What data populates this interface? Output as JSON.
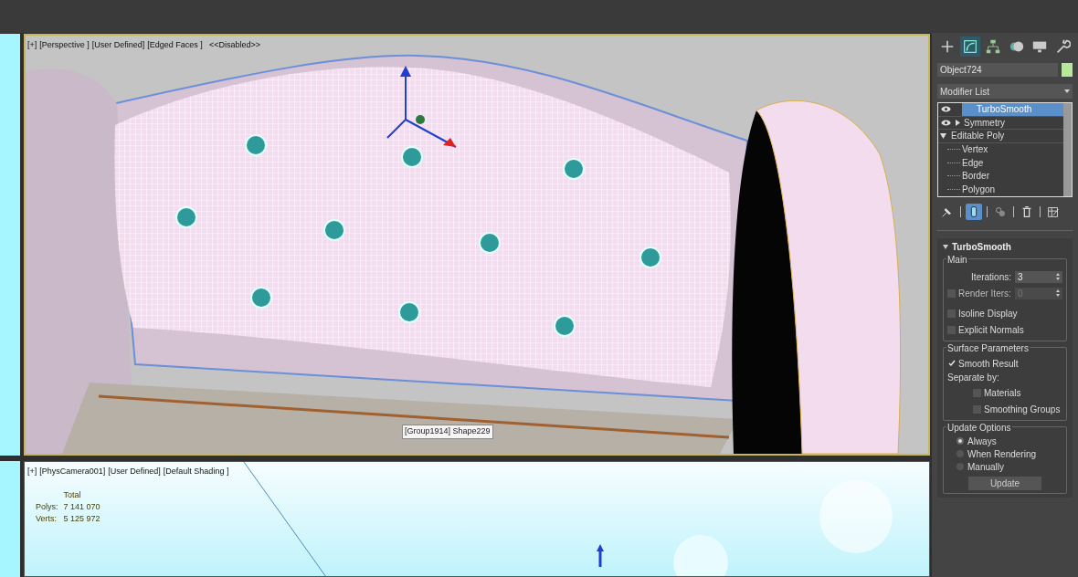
{
  "command_tabs": [
    {
      "kind": "create",
      "selected": false
    },
    {
      "kind": "modify",
      "selected": true
    },
    {
      "kind": "hierarchy",
      "selected": false
    },
    {
      "kind": "motion",
      "selected": false
    },
    {
      "kind": "display",
      "selected": false
    },
    {
      "kind": "utilities",
      "selected": false
    }
  ],
  "object_name": "Object724",
  "modifier_list": "Modifier List",
  "stack": [
    {
      "label": "TurboSmooth",
      "selected": true,
      "kind": "modifier",
      "expanded": false
    },
    {
      "label": "Symmetry",
      "selected": false,
      "kind": "collapsible",
      "expanded": false
    },
    {
      "label": "Editable Poly",
      "selected": false,
      "kind": "base",
      "expanded": true,
      "children": [
        {
          "label": "Vertex"
        },
        {
          "label": "Edge"
        },
        {
          "label": "Border"
        },
        {
          "label": "Polygon"
        }
      ]
    }
  ],
  "stack_tools": [
    {
      "kind": "pin",
      "selected": false
    },
    {
      "kind": "show-end-result",
      "selected": true
    },
    {
      "kind": "make-unique",
      "selected": false
    },
    {
      "kind": "remove",
      "selected": false
    },
    {
      "kind": "configure",
      "selected": false
    }
  ],
  "rollout": {
    "title": "TurboSmooth",
    "main": {
      "title": "Main",
      "iterations": {
        "label": "Iterations:",
        "value": "3"
      },
      "render_iters": {
        "label": "Render Iters:",
        "value": "0",
        "checked": false,
        "disabled": true
      },
      "checks": [
        {
          "label": "Isoline Display",
          "checked": false
        },
        {
          "label": "Explicit Normals",
          "checked": false
        }
      ]
    },
    "surface": {
      "title": "Surface Parameters",
      "smooth_result": {
        "label": "Smooth Result",
        "checked": true
      },
      "separate_by": "Separate by:",
      "checks": [
        {
          "label": "Materials",
          "checked": false
        },
        {
          "label": "Smoothing Groups",
          "checked": false
        }
      ]
    },
    "update": {
      "title": "Update Options",
      "options": [
        {
          "label": "Always",
          "selected": true
        },
        {
          "label": "When Rendering",
          "selected": false
        },
        {
          "label": "Manually",
          "selected": false
        }
      ],
      "button": "Update"
    }
  },
  "top_viewport": {
    "labels": [
      "[+]",
      "[Perspective ]",
      "[User Defined]",
      "[Edged Faces ]",
      "<<Disabled>>"
    ],
    "tooltip": "[Group1914] Shape229"
  },
  "bottom_viewport": {
    "labels": [
      "[+]",
      "[PhysCamera001]",
      "[User Defined]",
      "[Default Shading ]"
    ],
    "stats": {
      "header": "Total",
      "rows": [
        {
          "label": "Polys:",
          "value": "7 141 070"
        },
        {
          "label": "Verts:",
          "value": "5 125 972"
        }
      ]
    }
  }
}
